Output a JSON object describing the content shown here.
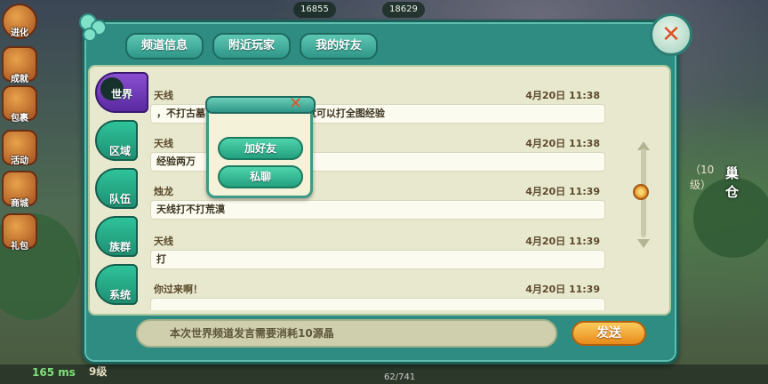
{
  "left_rail": {
    "items": [
      {
        "label": "进化"
      },
      {
        "label": "成就"
      },
      {
        "label": "包裹"
      },
      {
        "label": "活动"
      },
      {
        "label": "商城"
      },
      {
        "label": "礼包"
      }
    ]
  },
  "top_resources": {
    "coins": "16855",
    "gems": "18629"
  },
  "status": {
    "ping": "165 ms",
    "level": "9级",
    "exp": "62/741"
  },
  "right_side": {
    "level_text": "（10级）",
    "nest_label": "巢仓"
  },
  "tabs": [
    {
      "label": "频道信息"
    },
    {
      "label": "附近玩家"
    },
    {
      "label": "我的好友"
    }
  ],
  "channels": [
    {
      "label": "世界",
      "active": true
    },
    {
      "label": "区域",
      "active": false
    },
    {
      "label": "队伍",
      "active": false
    },
    {
      "label": "族群",
      "active": false
    },
    {
      "label": "系统",
      "active": false
    }
  ],
  "messages": [
    {
      "sender": "天线",
      "time": "4月20日 11:38",
      "text": "，不打古墓                                   蝴刀来只要一个半小时就可以打全图经验"
    },
    {
      "sender": "天线",
      "time": "4月20日 11:38",
      "text": "经验两万"
    },
    {
      "sender": "烛龙",
      "time": "4月20日 11:39",
      "text": "天线打不打荒漠"
    },
    {
      "sender": "天线",
      "time": "4月20日 11:39",
      "text": "打"
    },
    {
      "sender": "你过来啊！",
      "time": "4月20日 11:39",
      "text": ""
    }
  ],
  "input": {
    "hint": "本次世界频道发言需要消耗10源晶"
  },
  "send_label": "发送",
  "popup": {
    "add_friend": "加好友",
    "private_chat": "私聊"
  }
}
